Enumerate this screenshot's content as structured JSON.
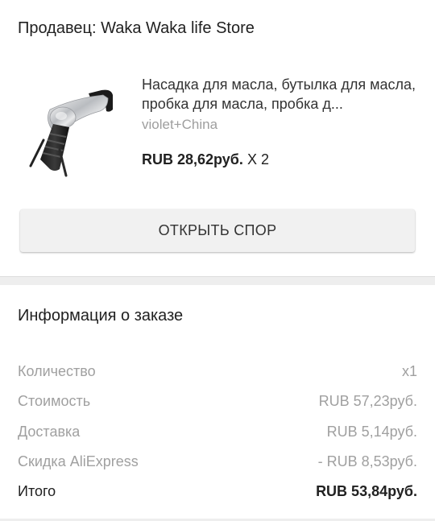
{
  "seller": {
    "title": "Продавец: Waka Waka life Store"
  },
  "product": {
    "image_icon": "oil-pourer-icon",
    "name": "Насадка для масла, бутылка для масла, пробка для масла, пробка д...",
    "variant": "violet+China",
    "price": "RUB 28,62руб.",
    "quantity": "X 2"
  },
  "actions": {
    "dispute_label": "ОТКРЫТЬ СПОР"
  },
  "order_info": {
    "title": "Информация о заказе",
    "rows": [
      {
        "label": "Количество",
        "value": "x1"
      },
      {
        "label": "Стоимость",
        "value": "RUB 57,23руб."
      },
      {
        "label": "Доставка",
        "value": "RUB 5,14руб."
      },
      {
        "label": "Скидка AliExpress",
        "value": "- RUB 8,53руб."
      }
    ],
    "total": {
      "label": "Итого",
      "value": "RUB 53,84руб."
    }
  }
}
